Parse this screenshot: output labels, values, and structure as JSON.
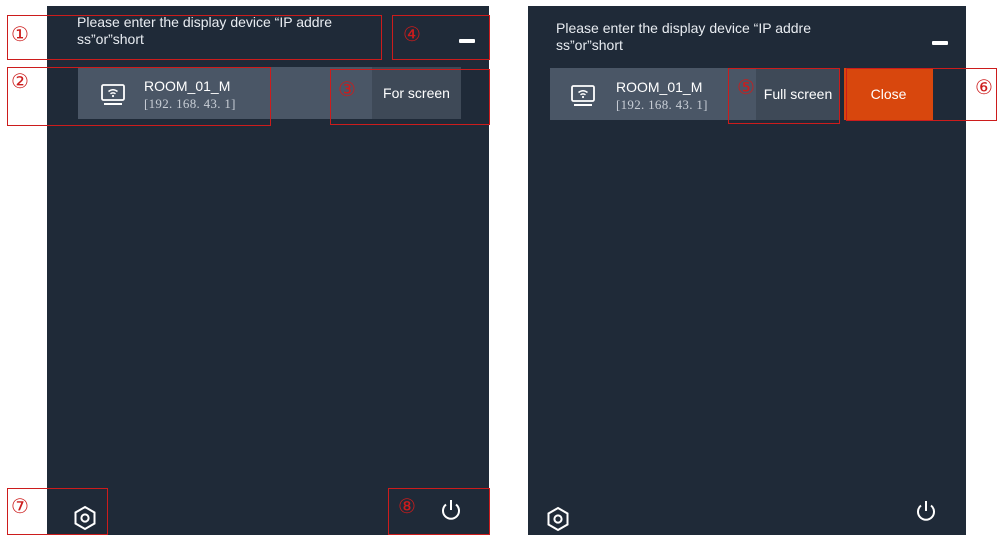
{
  "left_panel": {
    "prompt_line1": "Please enter the display device “IP addre",
    "prompt_line2": "ss”or”short",
    "device": {
      "name": "ROOM_01_M",
      "ip": "[192. 168. 43. 1]"
    },
    "screen_button_label": "For screen"
  },
  "right_panel": {
    "prompt_line1": "Please enter the display device “IP addre",
    "prompt_line2": "ss”or”short",
    "device": {
      "name": "ROOM_01_M",
      "ip": "[192. 168. 43. 1]"
    },
    "full_screen_label": "Full screen",
    "close_label": "Close"
  },
  "callouts": {
    "c1": "①",
    "c2": "②",
    "c3": "③",
    "c4": "④",
    "c5": "⑤",
    "c6": "⑥",
    "c7": "⑦",
    "c8": "⑧"
  },
  "icons": {
    "settings": "gear-icon",
    "power": "power-icon",
    "device": "wifi-display-icon",
    "minimize": "minimize-icon"
  },
  "colors": {
    "panel_bg": "#1f2a38",
    "device_card": "#4a5666",
    "screen_button": "#3e4957",
    "close_button": "#d8470d",
    "annotation": "#cc1c1c"
  }
}
